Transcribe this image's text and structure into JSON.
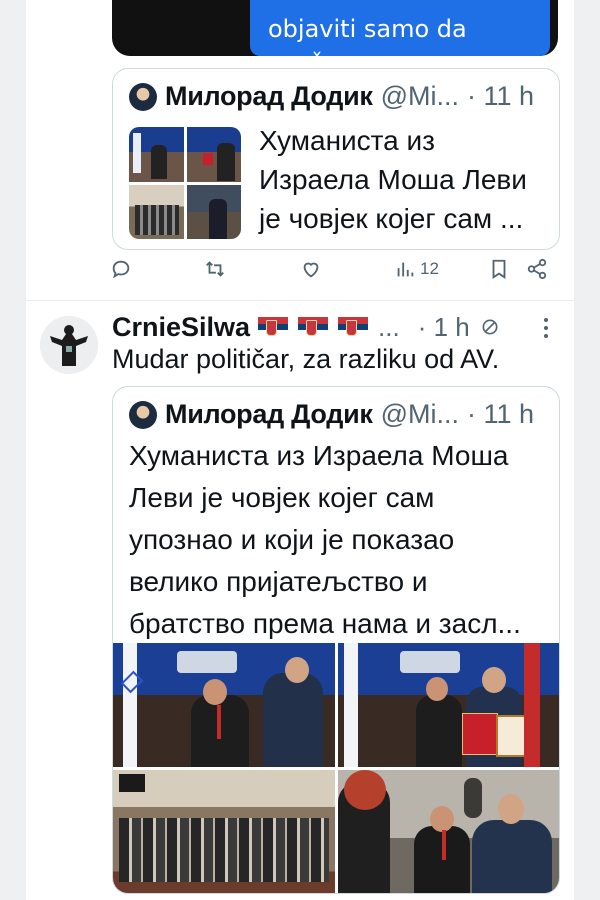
{
  "top_media": {
    "caption_lines": [
      "objaviti samo da",
      "znaš"
    ]
  },
  "quote1": {
    "author_name": "Милорад Додик",
    "author_handle": "@Mi...",
    "time": "· 11 h",
    "text_lines": [
      "Хуманиста из",
      "Израела Моша Леви",
      "је човјек којег сам ..."
    ]
  },
  "actions": {
    "reply_icon": "reply-icon",
    "retweet_icon": "retweet-icon",
    "like_icon": "heart-icon",
    "views_icon": "views-icon",
    "views_count": "12",
    "bookmark_icon": "bookmark-icon",
    "share_icon": "share-icon"
  },
  "tweet2": {
    "author_name": "CrnieSilwa",
    "flags": [
      "serbia-flag",
      "serbia-flag",
      "serbia-flag"
    ],
    "ellipsis": "...",
    "time": "· 1 h",
    "text": "Mudar političar, za razliku od AV."
  },
  "quote2": {
    "author_name": "Милорад Додик",
    "author_handle": "@Mi...",
    "time": "· 11 h",
    "text_lines": [
      "Хуманиста из Израела Моша",
      "Леви је човјек којег сам",
      "упознао и који је показао",
      "велико пријатељство и",
      "братство према нама и засл..."
    ]
  },
  "colors": {
    "blue_box": "#1f6fe6",
    "text_secondary": "#536471",
    "border": "#cfd9de"
  }
}
